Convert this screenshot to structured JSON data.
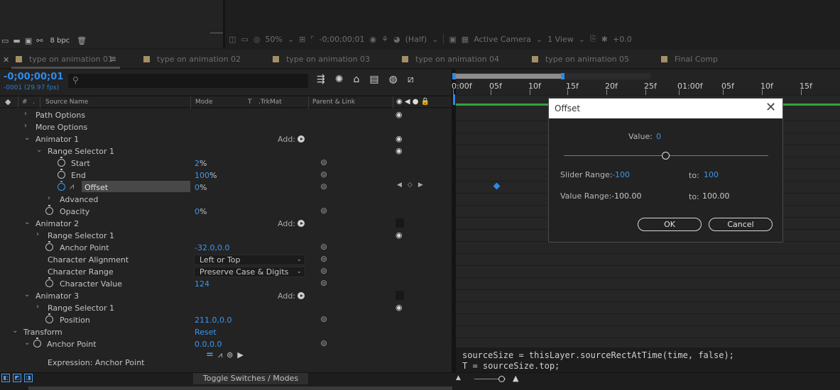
{
  "project_toolbar": {
    "bpc": "8 bpc"
  },
  "viewer_toolbar": {
    "zoom": "50%",
    "timecode": "-0;00;00;01",
    "resolution": "(Half)",
    "camera": "Active Camera",
    "views": "1 View",
    "exposure": "+0.0"
  },
  "tabs": [
    {
      "label": "type on animation 01",
      "color": "#a48f6a"
    },
    {
      "label": "type on animation 02",
      "color": "#a48f6a"
    },
    {
      "label": "type on animation 03",
      "color": "#a48f6a"
    },
    {
      "label": "type on animation 04",
      "color": "#a48f6a"
    },
    {
      "label": "type on animation 05",
      "color": "#a48f6a"
    },
    {
      "label": "Final Comp",
      "color": "#a48f6a"
    }
  ],
  "timeline": {
    "timecode": "-0;00;00;01",
    "fps": "-0001 (29.97 fps)",
    "columns": {
      "number": "#",
      "source_name": "Source Name",
      "mode": "Mode",
      "t": "T",
      "trkmat": ".TrkMat",
      "parent": "Parent & Link"
    },
    "ruler": [
      "0:00f",
      "05f",
      "10f",
      "15f",
      "20f",
      "25f",
      "01:00f",
      "05f",
      "10f",
      "15f"
    ],
    "accent_color": "#2e88e6"
  },
  "layers": {
    "path_options": "Path Options",
    "more_options": "More Options",
    "animator1": "Animator 1",
    "add_label": "Add:",
    "range_selector1": "Range Selector 1",
    "start": {
      "name": "Start",
      "value": "2",
      "unit": "%"
    },
    "end": {
      "name": "End",
      "value": "100",
      "unit": "%"
    },
    "offset": {
      "name": "Offset",
      "value": "0",
      "unit": "%"
    },
    "advanced": "Advanced",
    "opacity": {
      "name": "Opacity",
      "value": "0",
      "unit": "%"
    },
    "animator2": "Animator 2",
    "range_selector2": "Range Selector 1",
    "anchor_point_anim": {
      "name": "Anchor Point",
      "value": "-32.0,0.0"
    },
    "char_alignment": {
      "name": "Character Alignment",
      "value": "Left or Top"
    },
    "char_range": {
      "name": "Character Range",
      "value": "Preserve Case & Digits"
    },
    "char_value": {
      "name": "Character Value",
      "value": "124"
    },
    "animator3": "Animator 3",
    "range_selector3": "Range Selector 1",
    "position": {
      "name": "Position",
      "value": "211.0,0.0"
    },
    "transform": {
      "name": "Transform",
      "reset": "Reset"
    },
    "anchor_point": {
      "name": "Anchor Point",
      "value": "0.0,0.0"
    },
    "expression_label": "Expression: Anchor Point"
  },
  "expression_code": {
    "line1": "sourceSize = thisLayer.sourceRectAtTime(time, false);",
    "line2": "T = sourceSize.top;"
  },
  "bottom": {
    "toggle": "Toggle Switches / Modes"
  },
  "dialog": {
    "title": "Offset",
    "value_label": "Value:",
    "value": "0",
    "slider_position": 0.5,
    "slider_range_label": "Slider Range:",
    "slider_min": "-100",
    "to_label": "to:",
    "slider_max": "100",
    "value_range_label": "Value Range:",
    "value_min": "-100.00",
    "value_max": "100.00",
    "ok": "OK",
    "cancel": "Cancel"
  }
}
